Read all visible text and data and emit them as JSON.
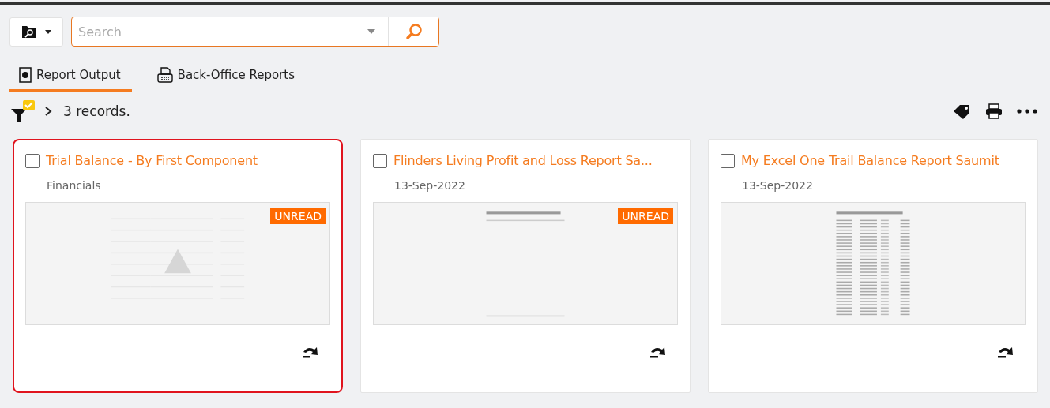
{
  "search": {
    "placeholder": "Search"
  },
  "tabs": [
    {
      "label": "Report Output",
      "kind": "report",
      "selected": true
    },
    {
      "label": "Back-Office Reports",
      "kind": "office",
      "selected": false
    }
  ],
  "records": {
    "count": "3 records."
  },
  "cards": [
    {
      "title": "Trial Balance - By First Component",
      "subtitle": "Financials",
      "checked": false,
      "selected": true,
      "badge": "UNREAD"
    },
    {
      "title": "Flinders Living Profit and Loss Report Sa...",
      "subtitle": "13-Sep-2022",
      "checked": false,
      "selected": false,
      "badge": "UNREAD"
    },
    {
      "title": "My Excel One Trail Balance Report Saumit",
      "subtitle": "13-Sep-2022",
      "checked": false,
      "selected": false
    }
  ]
}
